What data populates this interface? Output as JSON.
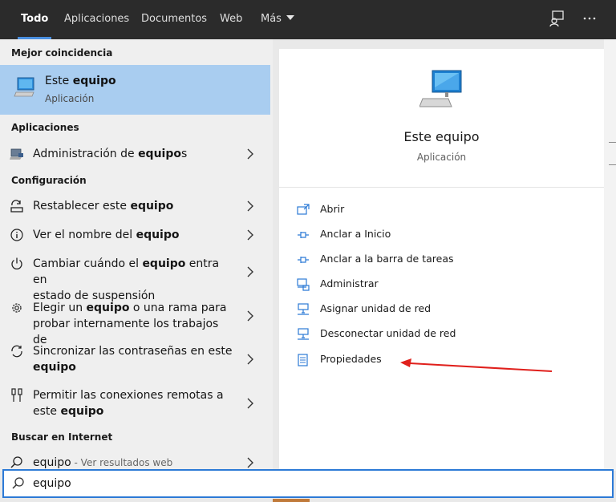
{
  "tabs": [
    {
      "label": "Todo",
      "active": true
    },
    {
      "label": "Aplicaciones"
    },
    {
      "label": "Documentos"
    },
    {
      "label": "Web"
    },
    {
      "label": "Más"
    }
  ],
  "sections": {
    "best_match": "Mejor coincidencia",
    "apps": "Aplicaciones",
    "settings": "Configuración",
    "web": "Buscar en Internet"
  },
  "best_match": {
    "title_pre": "Este ",
    "title_bold": "equipo",
    "subtitle": "Aplicación"
  },
  "apps": [
    {
      "pre": "Administración de ",
      "bold": "equipo",
      "post": "s"
    }
  ],
  "settings": [
    {
      "l1_pre": "Restablecer este ",
      "l1_bold": "equipo",
      "l1_post": ""
    },
    {
      "l1_pre": "Ver el nombre del ",
      "l1_bold": "equipo",
      "l1_post": ""
    },
    {
      "l1_pre": "Cambiar cuándo el ",
      "l1_bold": "equipo",
      "l1_post": " entra en",
      "l2": "estado de suspensión"
    },
    {
      "l1_pre": "Elegir un ",
      "l1_bold": "equipo",
      "l1_post": " o una rama para",
      "l2": "probar internamente los trabajos de"
    },
    {
      "l1_pre": "Sincronizar las contraseñas en este",
      "l2_bold": "equipo"
    },
    {
      "l1_pre": "Permitir las conexiones remotas a",
      "l2_pre": "este ",
      "l2_bold": "equipo"
    }
  ],
  "web_result": {
    "query": "equipo",
    "suffix": " - Ver resultados web"
  },
  "detail": {
    "title": "Este equipo",
    "subtitle": "Aplicación",
    "actions": [
      {
        "label": "Abrir",
        "icon": "open-window-icon"
      },
      {
        "label": "Anclar a Inicio",
        "icon": "pin-icon"
      },
      {
        "label": "Anclar a la barra de tareas",
        "icon": "pin-icon"
      },
      {
        "label": "Administrar",
        "icon": "manage-icon"
      },
      {
        "label": "Asignar unidad de red",
        "icon": "network-drive-icon"
      },
      {
        "label": "Desconectar unidad de red",
        "icon": "network-drive-icon"
      },
      {
        "label": "Propiedades",
        "icon": "properties-icon"
      }
    ]
  },
  "search": {
    "value": "equipo"
  },
  "colors": {
    "accent": "#2c7ad6",
    "selection": "#a9cdf0",
    "annotation_arrow": "#e0201c"
  }
}
